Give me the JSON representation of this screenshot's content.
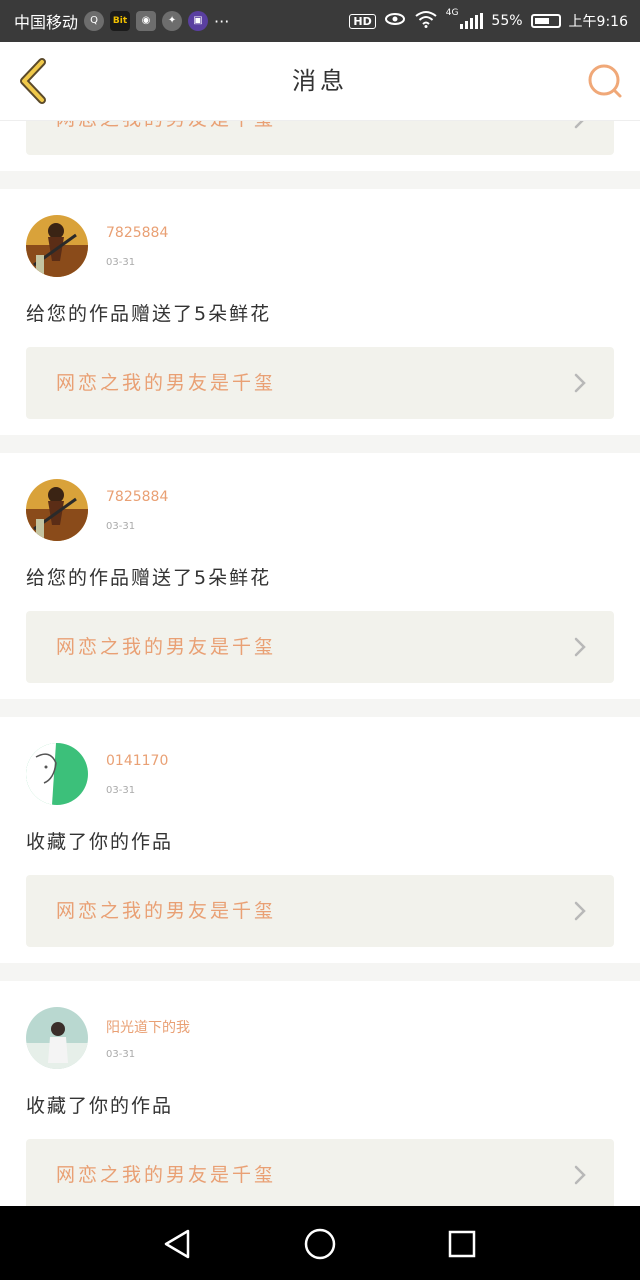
{
  "status_bar": {
    "carrier": "中国移动",
    "hd_badge": "HD",
    "network_type": "4G",
    "battery_level": "55%",
    "time": "上午9:16",
    "app_icons": [
      "qq-icon",
      "bilibili-icon",
      "wechat-icon",
      "tencent-icon",
      "game-icon"
    ],
    "more": "···"
  },
  "header": {
    "title": "消息",
    "back_icon": "chevron-left-icon",
    "search_icon": "search-icon",
    "accent_color": "#e9a074"
  },
  "top_card": {
    "work_title": "网恋之我的男友是千玺"
  },
  "messages": [
    {
      "username": "7825884",
      "date": "03-31",
      "text": "给您的作品赠送了5朵鲜花",
      "work_title": "网恋之我的男友是千玺",
      "avatar": "warrior-girl-avatar"
    },
    {
      "username": "7825884",
      "date": "03-31",
      "text": "给您的作品赠送了5朵鲜花",
      "work_title": "网恋之我的男友是千玺",
      "avatar": "warrior-girl-avatar"
    },
    {
      "username": "0141170",
      "date": "03-31",
      "text": "收藏了你的作品",
      "work_title": "网恋之我的男友是千玺",
      "avatar": "green-sketch-avatar"
    },
    {
      "username": "阳光道下的我",
      "date": "03-31",
      "text": "收藏了你的作品",
      "work_title": "网恋之我的男友是千玺",
      "avatar": "girl-photo-avatar"
    }
  ],
  "nav_bar": {
    "back": "triangle-back-icon",
    "home": "circle-home-icon",
    "recents": "square-recents-icon"
  }
}
